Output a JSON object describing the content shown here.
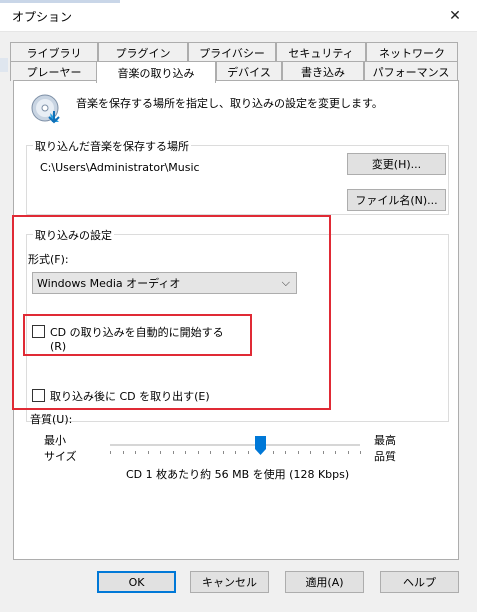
{
  "window": {
    "title": "オプション",
    "close_glyph": "✕"
  },
  "tabs_top": [
    "ライブラリ",
    "プラグイン",
    "プライバシー",
    "セキュリティ",
    "ネットワーク"
  ],
  "tabs_bottom": [
    "プレーヤー",
    "音楽の取り込み",
    "デバイス",
    "書き込み",
    "パフォーマンス"
  ],
  "active_tab": "音楽の取り込み",
  "intro_text": "音楽を保存する場所を指定し、取り込みの設定を変更します。",
  "save_location": {
    "title": "取り込んだ音楽を保存する場所",
    "path": "C:\\Users\\Administrator\\Music",
    "change_button": "変更(H)...",
    "filename_button": "ファイル名(N)..."
  },
  "rip_settings": {
    "title": "取り込みの設定",
    "format_label": "形式(F):",
    "format_value": "Windows Media オーディオ",
    "auto_rip_label": "CD の取り込みを自動的に開始する",
    "auto_rip_label2": "(R)",
    "auto_rip_checked": false,
    "eject_label": "取り込み後に CD を取り出す(E)",
    "eject_checked": false
  },
  "quality": {
    "label": "音質(U):",
    "min_label_1": "最小",
    "min_label_2": "サイズ",
    "max_label_1": "最高",
    "max_label_2": "品質",
    "slider_fraction": 0.6,
    "usage_text": "CD 1 枚あたり約 56 MB を使用 (128 Kbps)"
  },
  "buttons": {
    "ok": "OK",
    "cancel": "キャンセル",
    "apply": "適用(A)",
    "help": "ヘルプ"
  },
  "colors": {
    "highlight": "#e02a35",
    "slider_thumb": "#0078d7",
    "focus": "#0078d7"
  },
  "icons": {
    "cd": "cd-rip-icon",
    "close": "close-icon",
    "chevron": "chevron-down-icon"
  }
}
